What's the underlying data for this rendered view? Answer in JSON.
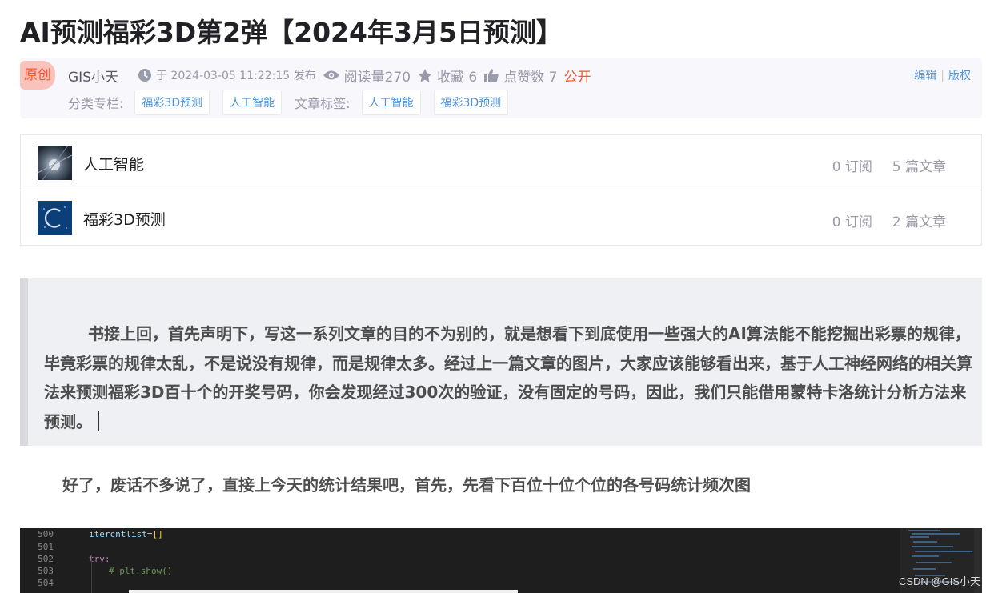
{
  "article": {
    "title": "AI预测福彩3D第2弹【2024年3月5日预测】"
  },
  "meta": {
    "badge": "原创",
    "author": "GIS小天",
    "publish_time": "于 2024-03-05 11:22:15 发布",
    "read_count": "阅读量270",
    "favorites": "收藏 6",
    "likes": "点赞数 7",
    "visibility": "公开",
    "edit_label": "编辑",
    "copyright_label": "版权",
    "category_label": "分类专栏:",
    "categories": [
      "福彩3D预测",
      "人工智能"
    ],
    "tag_label": "文章标签:",
    "tags": [
      "人工智能",
      "福彩3D预测"
    ]
  },
  "columns": [
    {
      "name": "人工智能",
      "subs": "0 订阅",
      "count": "5 篇文章"
    },
    {
      "name": "福彩3D预测",
      "subs": "0 订阅",
      "count": "2 篇文章"
    }
  ],
  "content": {
    "quote": "书接上回，首先声明下，写这一系列文章的目的不为别的，就是想看下到底使用一些强大的AI算法能不能挖掘出彩票的规律，毕竟彩票的规律太乱，不是说没有规律，而是规律太多。经过上一篇文章的图片，大家应该能够看出来，基于人工神经网络的相关算法来预测福彩3D百十个的开奖号码，你会发现经过300次的验证，没有固定的号码，因此，我们只能借用蒙特卡洛统计分析方法来预测。",
    "paragraph": "好了，废话不多说了，直接上今天的统计结果吧，首先，先看下百位十位个位的各号码统计频次图"
  },
  "code_image": {
    "line_numbers": [
      "500",
      "501",
      "502",
      "503",
      "504"
    ],
    "line_500_var": "itercntlist",
    "line_500_op": "=",
    "line_500_brackets": "[]",
    "line_502_kw": "try:",
    "line_503_comment": "# plt.show()",
    "watermark": "CSDN @GIS小天"
  }
}
